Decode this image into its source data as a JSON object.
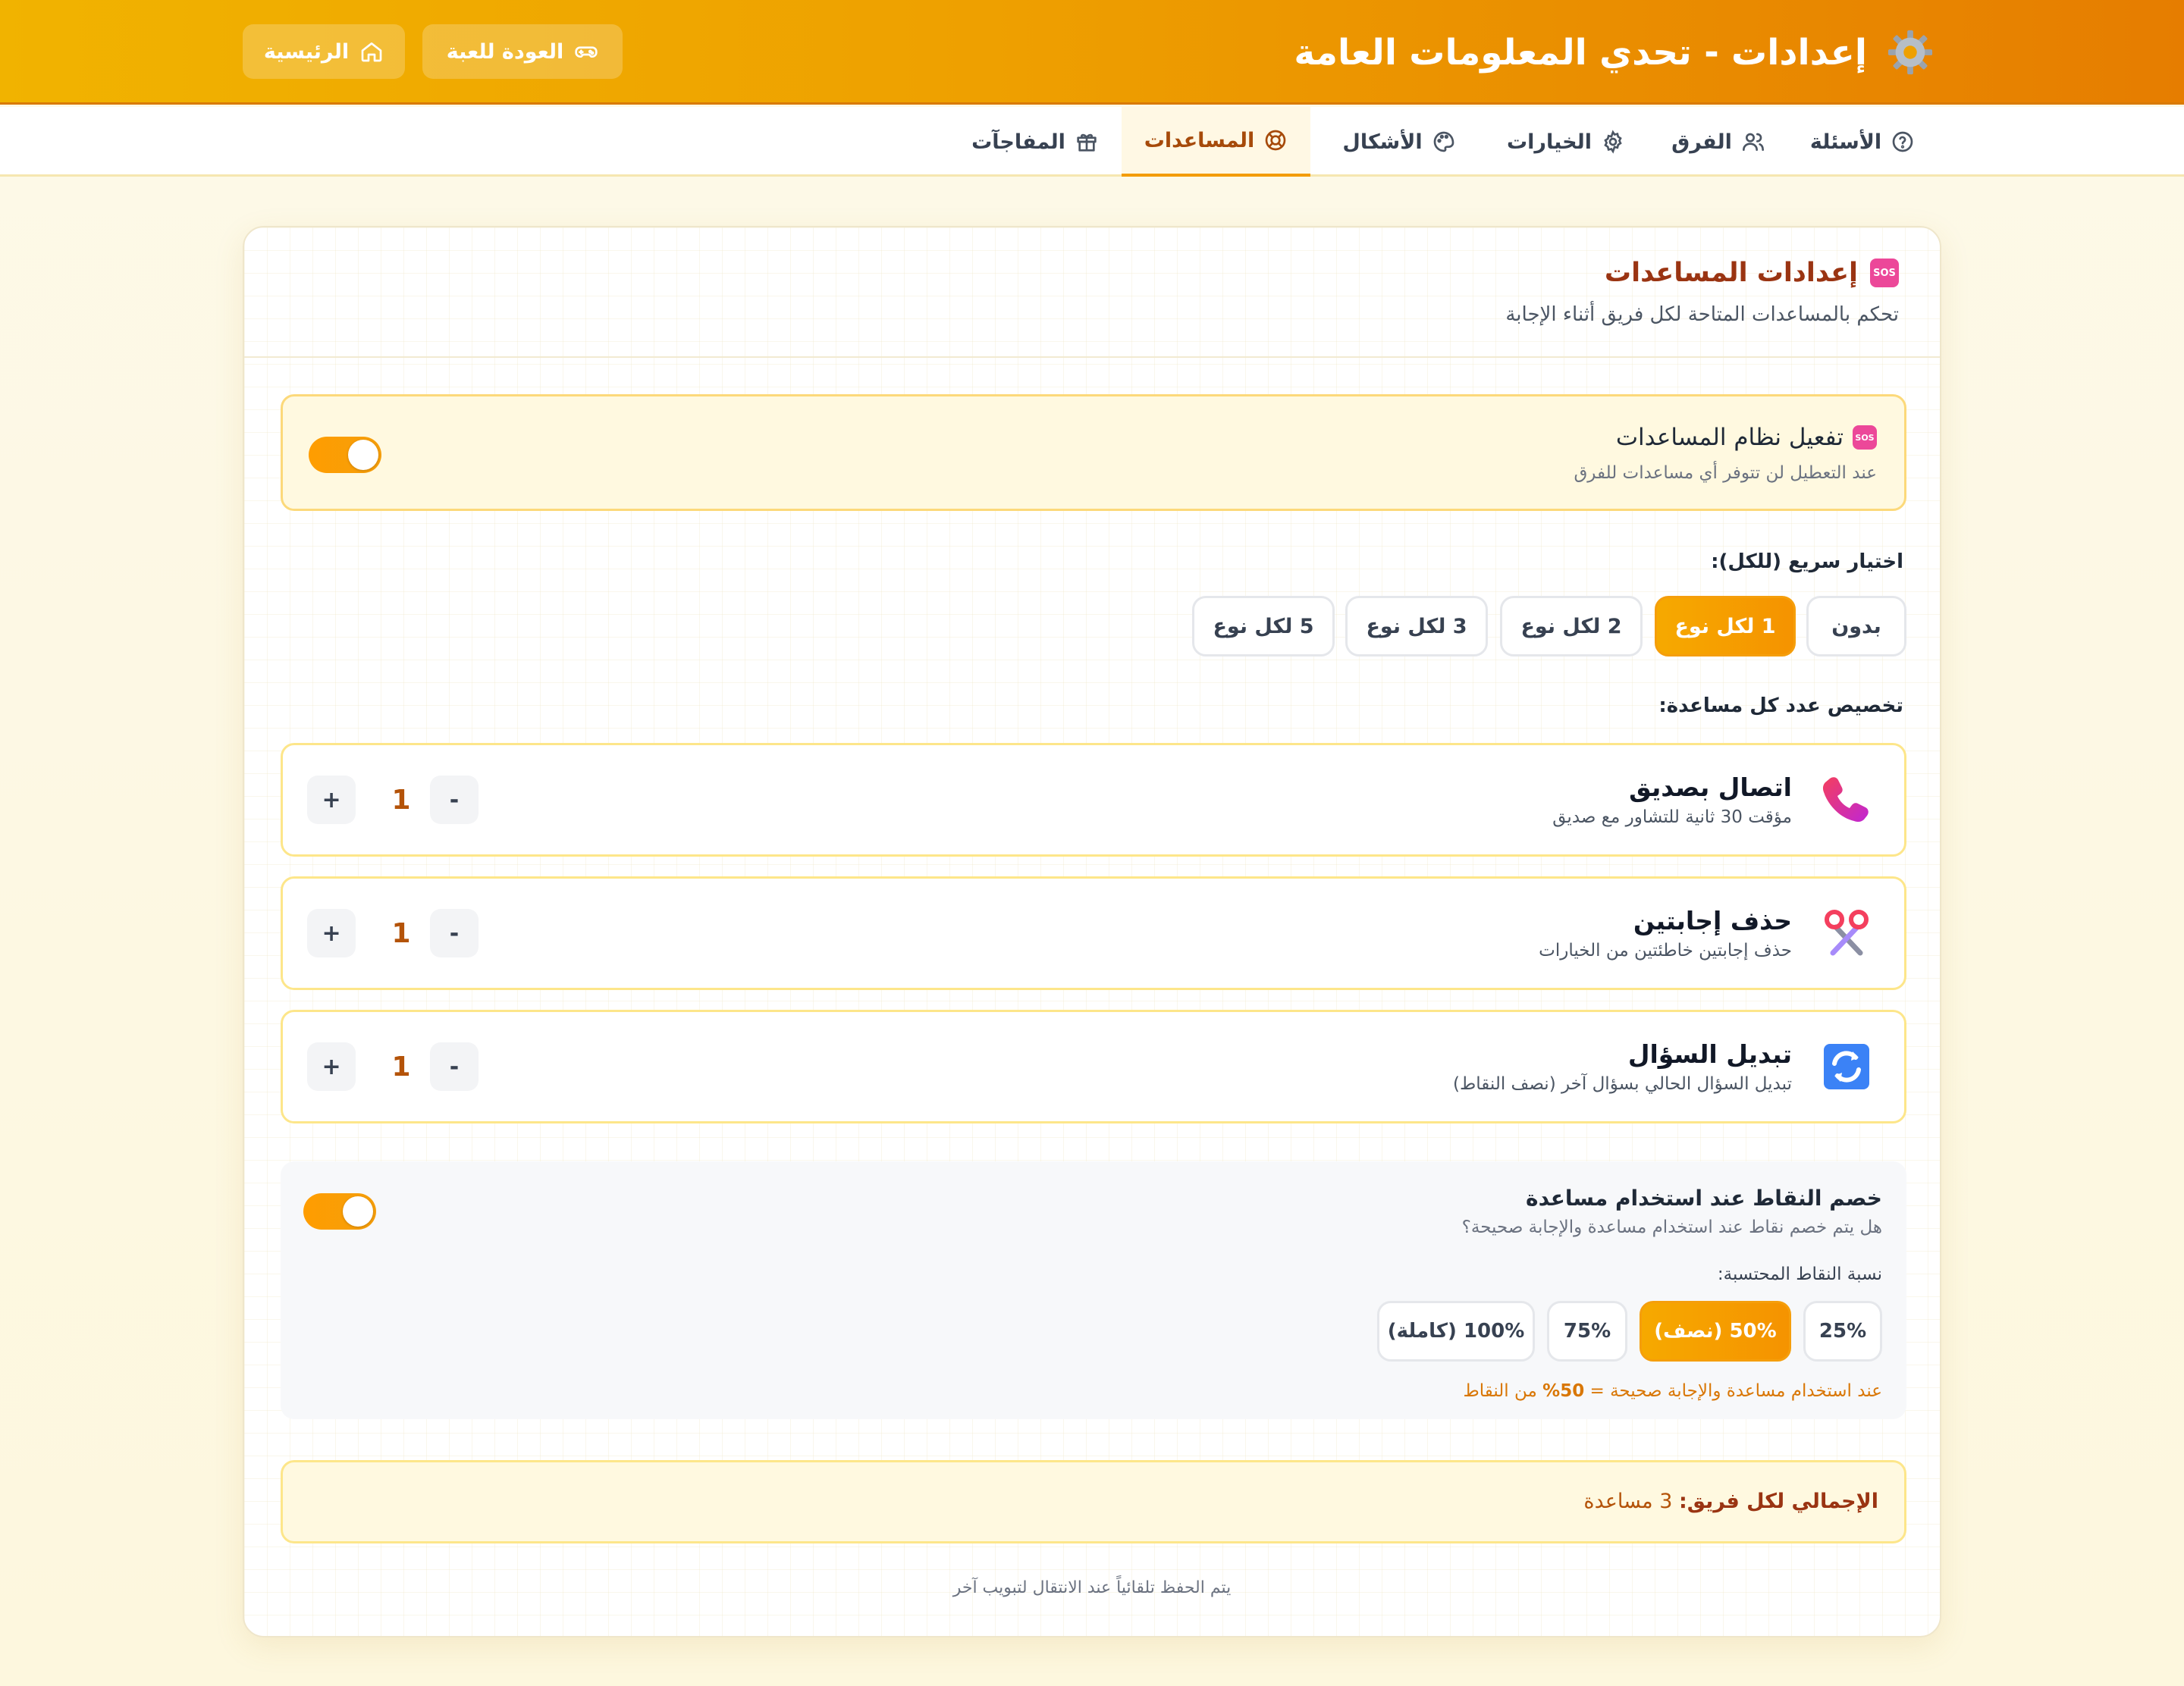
{
  "header": {
    "title": "إعدادات - تحدي المعلومات العامة",
    "back_to_game_label": "العودة للعبة",
    "home_label": "الرئيسية"
  },
  "tabs": [
    {
      "label": "الأسئلة",
      "icon": "help-circle-icon"
    },
    {
      "label": "الفرق",
      "icon": "users-icon"
    },
    {
      "label": "الخيارات",
      "icon": "gear-icon"
    },
    {
      "label": "الأشكال",
      "icon": "palette-icon"
    },
    {
      "label": "المساعدات",
      "icon": "lifebuoy-icon",
      "active": true
    },
    {
      "label": "المفاجآت",
      "icon": "gift-icon"
    }
  ],
  "section": {
    "title": "إعدادات المساعدات",
    "subtitle": "تحكم بالمساعدات المتاحة لكل فريق أثناء الإجابة",
    "sos_icon_text": "SOS"
  },
  "enable": {
    "title": "تفعيل نظام المساعدات",
    "description": "عند التعطيل لن تتوفر أي مساعدات للفرق",
    "enabled": true
  },
  "quick_select": {
    "label": "اختيار سريع (للكل):",
    "options": [
      "بدون",
      "1 لكل نوع",
      "2 لكل نوع",
      "3 لكل نوع",
      "5 لكل نوع"
    ],
    "selected": "1 لكل نوع"
  },
  "customize_label": "تخصيص عدد كل مساعدة:",
  "helps": [
    {
      "name": "اتصال بصديق",
      "description": "مؤقت 30 ثانية للتشاور مع صديق",
      "count": "1",
      "icon": "phone-icon"
    },
    {
      "name": "حذف إجابتين",
      "description": "حذف إجابتين خاطئتين من الخيارات",
      "count": "1",
      "icon": "scissors-icon"
    },
    {
      "name": "تبديل السؤال",
      "description": "تبديل السؤال الحالي بسؤال آخر (نصف النقاط)",
      "count": "1",
      "icon": "swap-icon"
    }
  ],
  "stepper": {
    "minus": "-",
    "plus": "+"
  },
  "deduction": {
    "title": "خصم النقاط عند استخدام مساعدة",
    "description": "هل يتم خصم نقاط عند استخدام مساعدة والإجابة صحيحة؟",
    "enabled": true,
    "percent_label": "نسبة النقاط المحتسبة:",
    "options": [
      "25%",
      "50% (نصف)",
      "75%",
      "100% (كاملة)"
    ],
    "selected": "50% (نصف)",
    "note_prefix": "عند استخدام مساعدة والإجابة صحيحة = ",
    "note_value": "50%",
    "note_suffix": " من النقاط"
  },
  "total": {
    "label": "الإجمالي لكل فريق:",
    "value": " 3 مساعدة"
  },
  "autosave_note": "يتم الحفظ تلقائياً عند الانتقال لتبويب آخر",
  "colors": {
    "header_start": "#f1b300",
    "header_end": "#e67d00",
    "accent": "#f59e0b",
    "accent_text": "#9a3412"
  }
}
